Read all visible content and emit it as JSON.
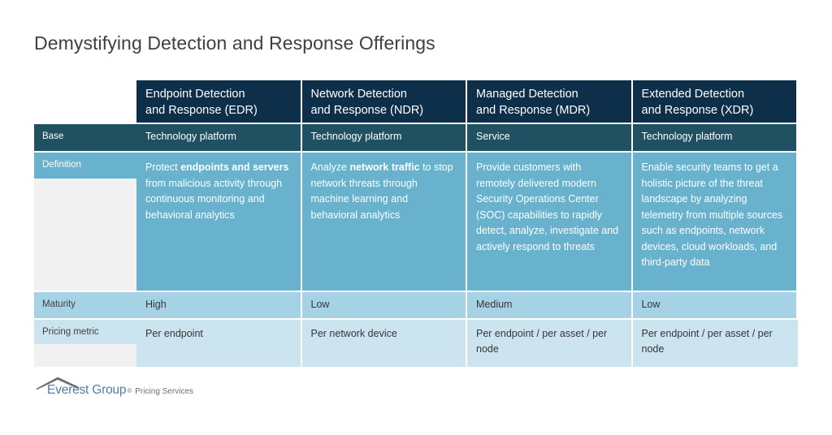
{
  "slide": {
    "title": "Demystifying Detection and Response Offerings"
  },
  "table": {
    "columns": [
      {
        "id": "edr",
        "header_line1": "Endpoint Detection",
        "header_line2": "and Response (EDR)"
      },
      {
        "id": "ndr",
        "header_line1": "Network Detection",
        "header_line2": "and Response (NDR)"
      },
      {
        "id": "mdr",
        "header_line1": "Managed Detection",
        "header_line2": "and Response (MDR)"
      },
      {
        "id": "xdr",
        "header_line1": "Extended Detection",
        "header_line2": "and Response (XDR)"
      }
    ],
    "rows": {
      "base": {
        "label": "Base",
        "values": [
          "Technology platform",
          "Technology platform",
          "Service",
          "Technology platform"
        ]
      },
      "definition": {
        "label": "Definition",
        "values": {
          "edr_pre": "Protect ",
          "edr_bold": "endpoints and servers",
          "edr_post": " from malicious activity through continuous monitoring and behavioral analytics",
          "ndr_pre": "Analyze ",
          "ndr_bold": "network traffic",
          "ndr_post": " to stop network threats through machine learning and behavioral analytics",
          "mdr": "Provide customers with remotely delivered modern Security Operations Center (SOC) capabilities to rapidly detect, analyze, investigate and actively respond to threats",
          "xdr": "Enable security teams to get a holistic picture of the threat landscape by analyzing telemetry from multiple sources such as endpoints, network devices, cloud workloads, and third-party data"
        }
      },
      "maturity": {
        "label": "Maturity",
        "values": [
          "High",
          "Low",
          "Medium",
          "Low"
        ]
      },
      "pricing": {
        "label": "Pricing metric",
        "values": [
          "Per endpoint",
          "Per network device",
          "Per endpoint / per asset / per node",
          "Per endpoint / per asset / per node"
        ]
      }
    }
  },
  "footer": {
    "logo_name": "Everest Group",
    "logo_registered": "®",
    "logo_tagline": "Pricing Services",
    "logo_icon": "chevron-roof-icon"
  },
  "colors": {
    "header_navy": "#0e2f4a",
    "base_teal": "#1f5163",
    "definition_blue": "#68b2ce",
    "maturity_blue": "#a5d3e5",
    "pricing_blue": "#cbe4f0",
    "label_filler_gray": "#f1f1f1",
    "title_gray": "#404040",
    "logo_blue": "#4b7fa8"
  }
}
